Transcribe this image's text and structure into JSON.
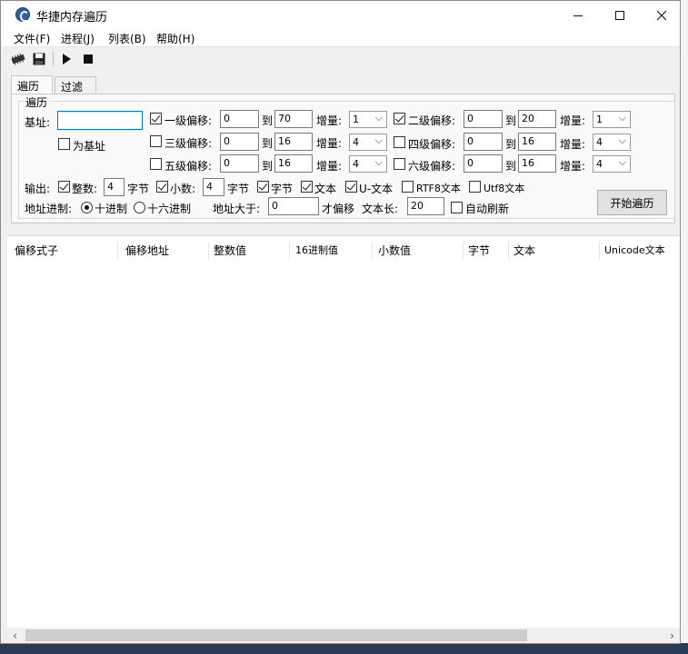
{
  "window": {
    "title": "华捷内存遍历"
  },
  "menu": [
    "文件(F)",
    "进程(J)",
    "列表(B)",
    "帮助(H)"
  ],
  "tabs": [
    "遍历",
    "过滤"
  ],
  "traverse": {
    "group_title": "遍历",
    "base_label": "基址:",
    "base_value": "",
    "is_base_label": "为基址",
    "to_label": "到",
    "inc_label": "增量:",
    "offsets": [
      {
        "label": "一级偏移:",
        "checked": true,
        "from": "0",
        "to": "70",
        "inc": "1"
      },
      {
        "label": "二级偏移:",
        "checked": true,
        "from": "0",
        "to": "20",
        "inc": "1"
      },
      {
        "label": "三级偏移:",
        "checked": false,
        "from": "0",
        "to": "16",
        "inc": "4"
      },
      {
        "label": "四级偏移:",
        "checked": false,
        "from": "0",
        "to": "16",
        "inc": "4"
      },
      {
        "label": "五级偏移:",
        "checked": false,
        "from": "0",
        "to": "16",
        "inc": "4"
      },
      {
        "label": "六级偏移:",
        "checked": false,
        "from": "0",
        "to": "16",
        "inc": "4"
      }
    ],
    "output_label": "输出:",
    "int_label": "整数:",
    "int_bytes": "4",
    "bytes_unit": "字节",
    "float_label": "小数:",
    "float_bytes": "4",
    "byte_label": "字节",
    "text_label": "文本",
    "utext_label": "U-文本",
    "rtf8_label": "RTF8文本",
    "utf8_label": "Utf8文本",
    "start_button": "开始遍历",
    "addr_base_label": "地址进制:",
    "dec_label": "十进制",
    "hex_label": "十六进制",
    "addr_gt_label": "地址大于:",
    "addr_gt_value": "0",
    "only_offset_label": "才偏移",
    "text_len_label": "文本长:",
    "text_len_value": "20",
    "auto_refresh_label": "自动刷新"
  },
  "columns": [
    "偏移式子",
    "偏移地址",
    "整数值",
    "16进制值",
    "小数值",
    "字节",
    "文本",
    "Unicode文本"
  ]
}
